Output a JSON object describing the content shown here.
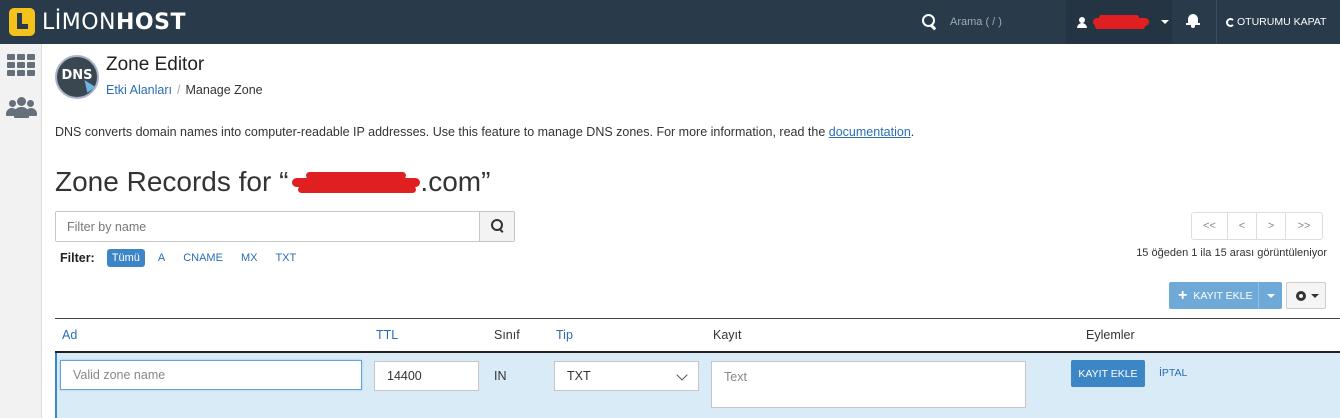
{
  "brand": {
    "name_light": "LİMON",
    "name_bold": "HOST"
  },
  "topbar": {
    "search_placeholder": "Arama ( / )",
    "logout_label": "OTURUMU KAPAT"
  },
  "header": {
    "logo_text": "DNS",
    "title": "Zone Editor",
    "breadcrumb": {
      "parent": "Etki Alanları",
      "current": "Manage Zone"
    }
  },
  "intro": {
    "text": "DNS converts domain names into computer-readable IP addresses. Use this feature to manage DNS zones. For more information, read the ",
    "link": "documentation",
    "suffix": "."
  },
  "zone": {
    "title_prefix": "Zone Records for “",
    "domain_visible": ".com”"
  },
  "filter": {
    "placeholder": "Filter by name",
    "label": "Filter:",
    "chips": [
      "Tümü",
      "A",
      "CNAME",
      "MX",
      "TXT"
    ]
  },
  "pager": {
    "first": "<<",
    "prev": "<",
    "next": ">",
    "last": ">>",
    "info": "15 öğeden 1 ila 15 arası görüntüleniyor"
  },
  "actions": {
    "add_record": "KAYIT EKLE"
  },
  "table": {
    "columns": [
      "Ad",
      "TTL",
      "Sınıf",
      "Tip",
      "Kayıt",
      "Eylemler"
    ]
  },
  "edit_row": {
    "name_placeholder": "Valid zone name",
    "ttl": "14400",
    "class": "IN",
    "type": "TXT",
    "record_placeholder": "Text",
    "save_label": "KAYIT EKLE",
    "cancel_label": "İPTAL"
  },
  "colors": {
    "topbar": "#293a4a",
    "brand_yellow": "#f5c21b",
    "link": "#2a6db5",
    "primary_button": "#3d86c6",
    "edit_row_bg": "#d8ebf7"
  }
}
